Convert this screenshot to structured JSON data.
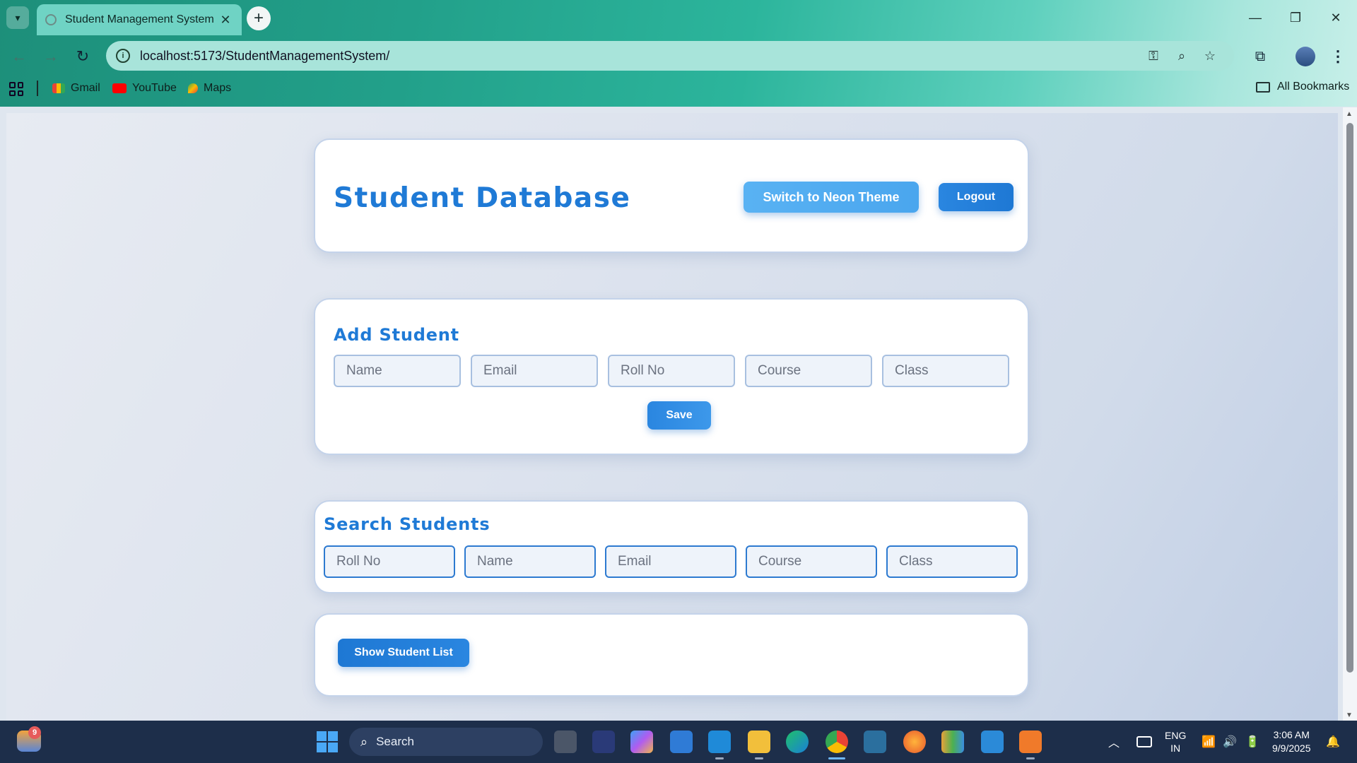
{
  "browser": {
    "tab_title": "Student Management System",
    "url": "localhost:5173/StudentManagementSystem/",
    "bookmarks": [
      "Gmail",
      "YouTube",
      "Maps"
    ],
    "all_bookmarks": "All Bookmarks"
  },
  "header": {
    "title": "Student Database",
    "theme_button": "Switch to Neon Theme",
    "logout_button": "Logout"
  },
  "add_student": {
    "title": "Add Student",
    "placeholders": [
      "Name",
      "Email",
      "Roll No",
      "Course",
      "Class"
    ],
    "save_button": "Save"
  },
  "search_students": {
    "title": "Search Students",
    "placeholders": [
      "Roll No",
      "Name",
      "Email",
      "Course",
      "Class"
    ]
  },
  "show_list": {
    "button": "Show Student List"
  },
  "taskbar": {
    "notification_count": "9",
    "search_label": "Search",
    "language": [
      "ENG",
      "IN"
    ],
    "time": "3:06 AM",
    "date": "9/9/2025"
  },
  "colors": {
    "accent": "#1f7ad6",
    "taskbar": "#1d2e4a"
  }
}
